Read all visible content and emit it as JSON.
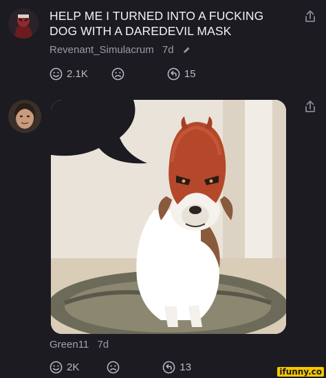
{
  "post": {
    "title_line1": "HELP ME I TURNED INTO A FUCKING",
    "title_line2": "DOG WITH A DAREDEVIL MASK",
    "author": "Revenant_Simulacrum",
    "age": "7d",
    "smile_count": "2.1K",
    "reply_count": "15"
  },
  "reply": {
    "author": "Green11",
    "age": "7d",
    "smile_count": "2K",
    "reply_count": "13",
    "image_icon": "dog-in-daredevil-mask-image"
  },
  "watermark": {
    "prefix": "",
    "brand": "ifunny.co"
  },
  "colors": {
    "background": "#1c1b21",
    "muted": "#9c9aa6",
    "mask": "#b5482a",
    "watermark": "#f6c700"
  }
}
